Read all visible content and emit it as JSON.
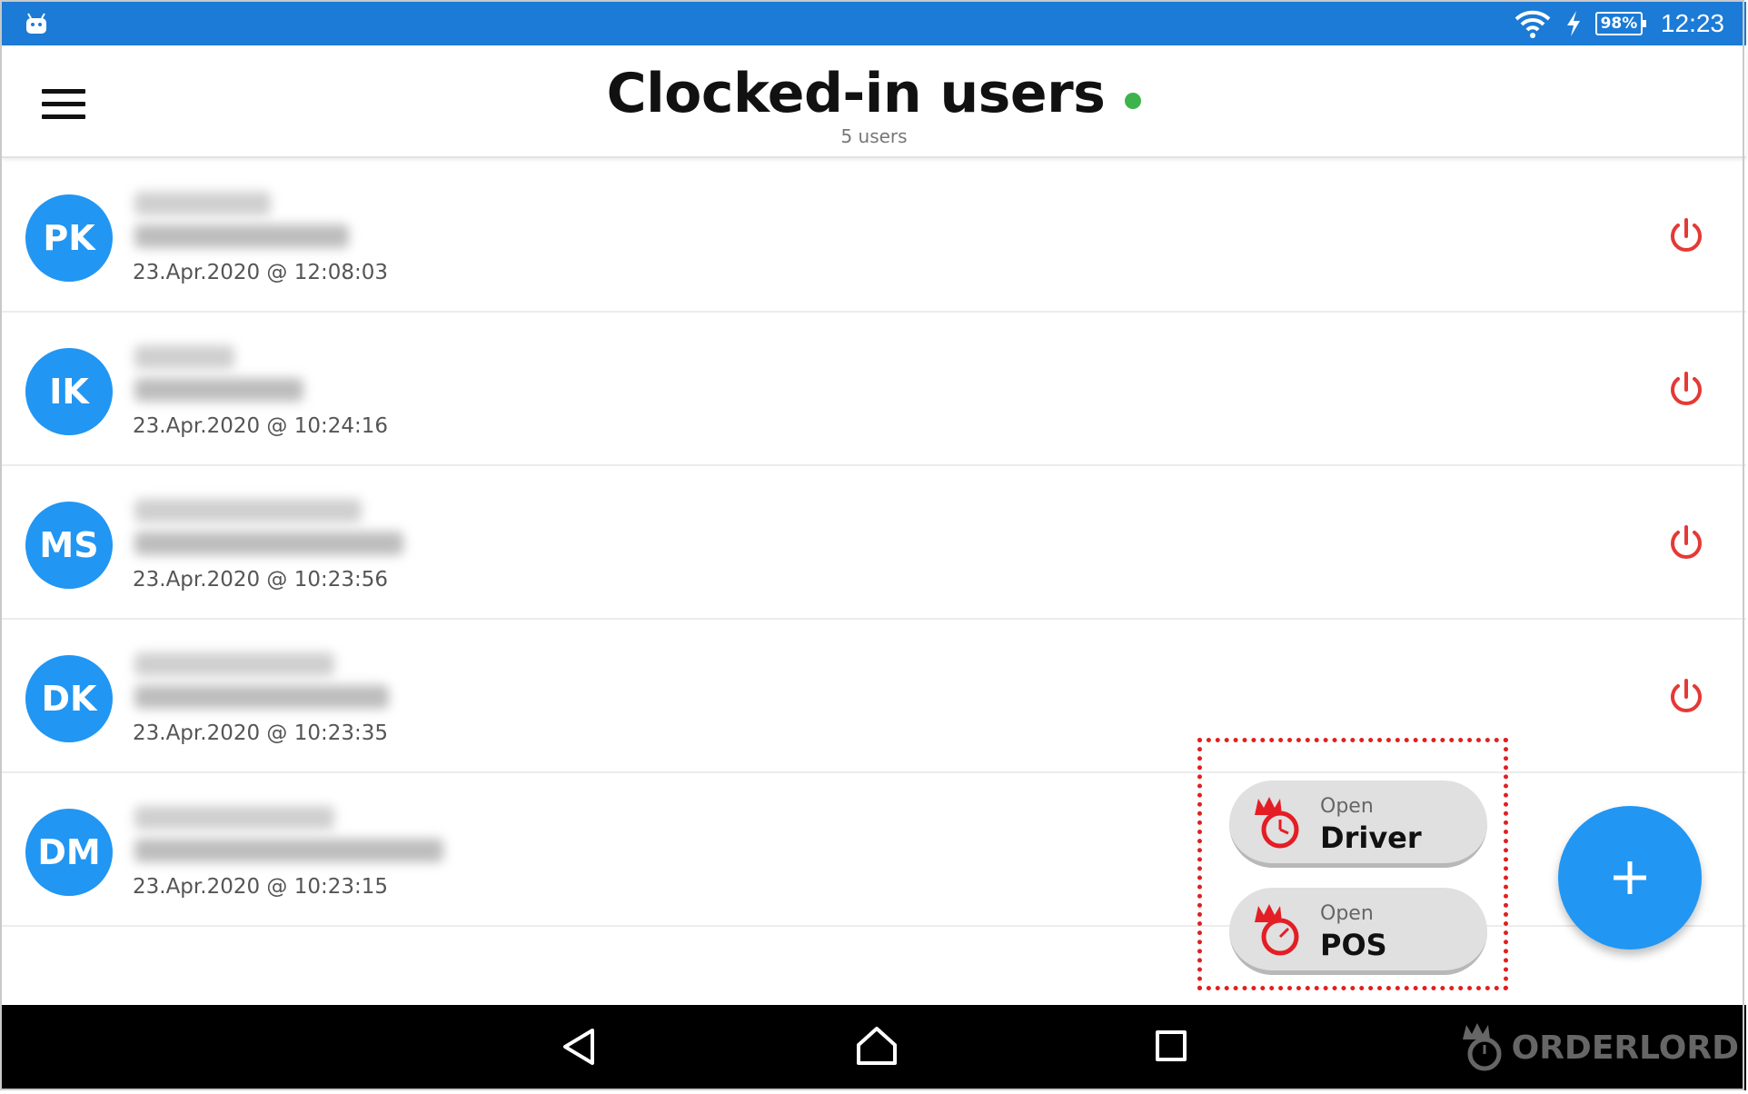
{
  "status_bar": {
    "battery": "98%",
    "time": "12:23",
    "icons": [
      "android-debug-icon",
      "wifi-icon",
      "charging-bolt-icon",
      "battery-icon"
    ],
    "background": "#1b7bd6"
  },
  "header": {
    "title": "Clocked-in users",
    "subtitle": "5 users",
    "online_color": "#3cb44b"
  },
  "users": [
    {
      "initials": "PK",
      "clocked_in_at": "23.Apr.2020 @ 12:08:03"
    },
    {
      "initials": "IK",
      "clocked_in_at": "23.Apr.2020 @ 10:24:16"
    },
    {
      "initials": "MS",
      "clocked_in_at": "23.Apr.2020 @ 10:23:56"
    },
    {
      "initials": "DK",
      "clocked_in_at": "23.Apr.2020 @ 10:23:35"
    },
    {
      "initials": "DM",
      "clocked_in_at": "23.Apr.2020 @ 10:23:15"
    }
  ],
  "quick_actions": [
    {
      "prefix": "Open",
      "label": "Driver"
    },
    {
      "prefix": "Open",
      "label": "POS"
    }
  ],
  "fab": {
    "icon": "plus-icon",
    "color": "#2196f3"
  },
  "nav_bar": {
    "icons": [
      "back-icon",
      "home-icon",
      "recent-apps-icon"
    ]
  },
  "brand": {
    "name": "ORDERLORD"
  },
  "colors": {
    "accent": "#2196f3",
    "danger": "#e53935",
    "highlight_border": "#e02020"
  }
}
